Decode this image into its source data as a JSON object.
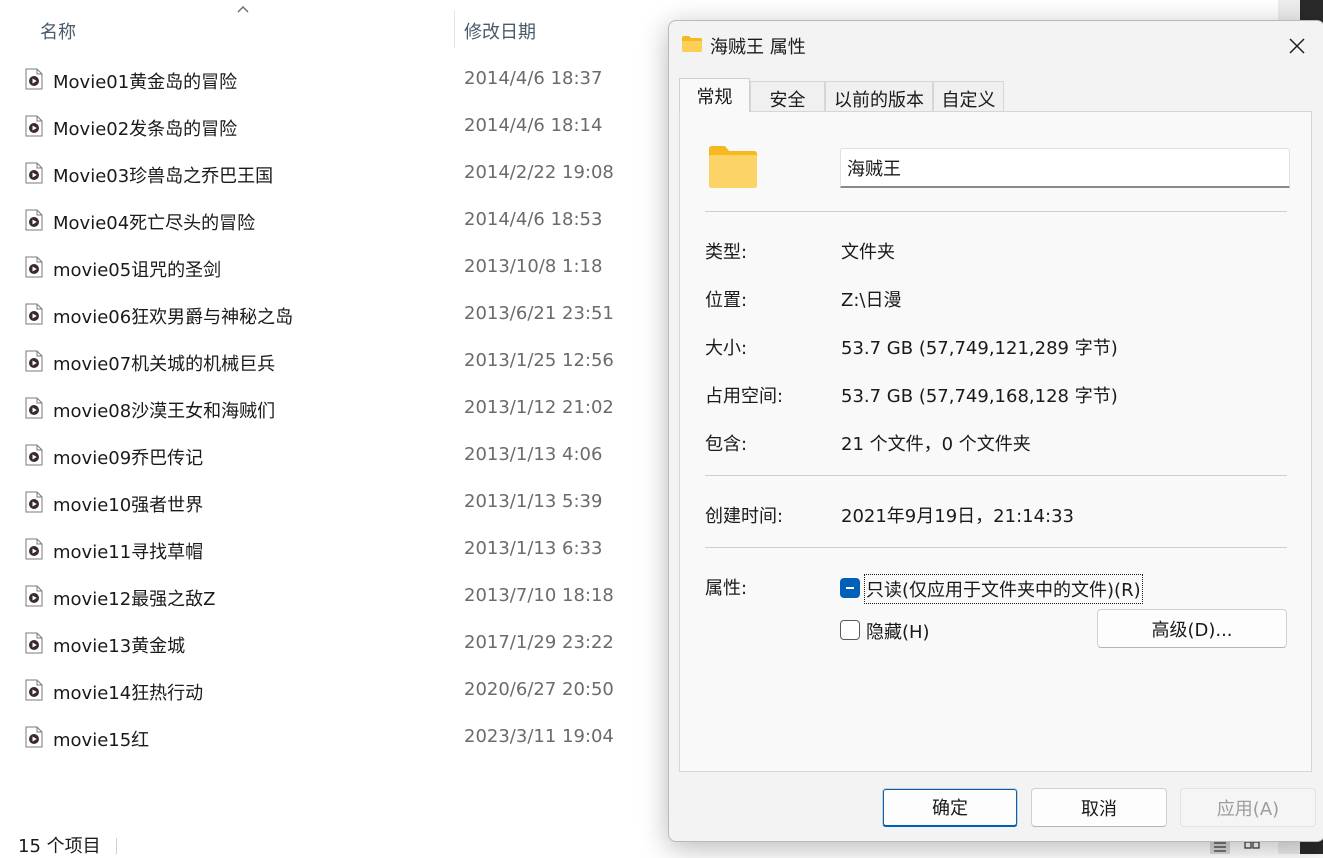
{
  "explorer": {
    "columns": {
      "name": "名称",
      "date": "修改日期"
    },
    "files": [
      {
        "name": "Movie01黄金岛的冒险",
        "date": "2014/4/6 18:37"
      },
      {
        "name": "Movie02发条岛的冒险",
        "date": "2014/4/6 18:14"
      },
      {
        "name": "Movie03珍兽岛之乔巴王国",
        "date": "2014/2/22 19:08"
      },
      {
        "name": "Movie04死亡尽头的冒险",
        "date": "2014/4/6 18:53"
      },
      {
        "name": "movie05诅咒的圣剑",
        "date": "2013/10/8 1:18"
      },
      {
        "name": "movie06狂欢男爵与神秘之岛",
        "date": "2013/6/21 23:51"
      },
      {
        "name": "movie07机关城的机械巨兵",
        "date": "2013/1/25 12:56"
      },
      {
        "name": "movie08沙漠王女和海贼们",
        "date": "2013/1/12 21:02"
      },
      {
        "name": "movie09乔巴传记",
        "date": "2013/1/13 4:06"
      },
      {
        "name": "movie10强者世界",
        "date": "2013/1/13 5:39"
      },
      {
        "name": "movie11寻找草帽",
        "date": "2013/1/13 6:33"
      },
      {
        "name": "movie12最强之敌Z",
        "date": "2013/7/10 18:18"
      },
      {
        "name": "movie13黄金城",
        "date": "2017/1/29 23:22"
      },
      {
        "name": "movie14狂热行动",
        "date": "2020/6/27 20:50"
      },
      {
        "name": "movie15红",
        "date": "2023/3/11 19:04"
      }
    ],
    "status": {
      "count": "15 个项目"
    }
  },
  "dialog": {
    "title": "海贼王 属性",
    "tabs": [
      {
        "label": "常规"
      },
      {
        "label": "安全"
      },
      {
        "label": "以前的版本"
      },
      {
        "label": "自定义"
      }
    ],
    "folder_name": "海贼王",
    "props": {
      "type_label": "类型:",
      "type_value": "文件夹",
      "location_label": "位置:",
      "location_value": "Z:\\日漫",
      "size_label": "大小:",
      "size_value": "53.7 GB (57,749,121,289 字节)",
      "disk_label": "占用空间:",
      "disk_value": "53.7 GB (57,749,168,128 字节)",
      "contains_label": "包含:",
      "contains_value": "21 个文件，0 个文件夹",
      "created_label": "创建时间:",
      "created_value": "2021年9月19日，21:14:33",
      "attributes_label": "属性:"
    },
    "attributes": {
      "readonly_label": "只读(仅应用于文件夹中的文件)(R)",
      "readonly_state": "indeterminate",
      "hidden_label": "隐藏(H)",
      "hidden_state": "unchecked",
      "advanced_label": "高级(D)..."
    },
    "buttons": {
      "ok": "确定",
      "cancel": "取消",
      "apply": "应用(A)"
    }
  },
  "colors": {
    "accent": "#005fb8",
    "folder_yellow": "#f8c440",
    "dialog_bg": "#f3f3f3",
    "panel_bg": "#f9f9f9"
  },
  "icons": {
    "file": "video-file-icon",
    "folder": "folder-icon",
    "close": "close-icon",
    "sort": "sort-ascending-icon"
  }
}
